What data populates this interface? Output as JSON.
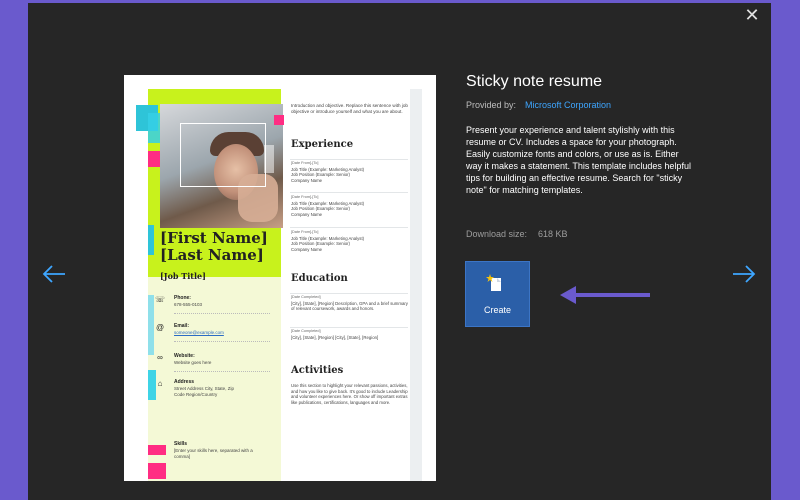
{
  "dialog": {
    "close_glyph": "✕"
  },
  "template": {
    "title": "Sticky note resume",
    "provided_by_label": "Provided by:",
    "provider": "Microsoft Corporation",
    "description": "Present your experience and talent stylishly with this resume or CV.  Includes a space for your photograph.  Easily customize fonts and colors, or use as is.  Either way it makes a statement. This template includes helpful tips for building an effective resume. Search for \"sticky note\" for matching templates.",
    "download_size_label": "Download size:",
    "download_size": "618 KB",
    "create_label": "Create"
  },
  "preview": {
    "name_line1": "[First Name]",
    "name_line2": "[Last Name]",
    "job_title": "[Job Title]",
    "intro": "Introduction and objective. Replace this sentence with job objective or introduce yourself and what you are about.",
    "contact": [
      {
        "icon": "☏",
        "label": "Phone:",
        "value": "678-555-0103"
      },
      {
        "icon": "@",
        "label": "Email:",
        "value": "someone@example.com"
      },
      {
        "icon": "∞",
        "label": "Website:",
        "value": "Website goes here"
      },
      {
        "icon": "⌂",
        "label": "Address",
        "value": "Street Address City, State, Zip Code Region/Country"
      },
      {
        "icon": "",
        "label": "Skills",
        "value": "[Enter your skills here, separated with a comma]"
      }
    ],
    "experience_heading": "Experience",
    "experience": [
      {
        "dates": "[Date From]-[To]",
        "title": "Job Title (Example: Marketing Analyst)",
        "position": "Job Position (Example: Senior)",
        "company": "Company Name"
      },
      {
        "dates": "[Date From]-[To]",
        "title": "Job Title (Example: Marketing Analyst)",
        "position": "Job Position (Example: Senior)",
        "company": "Company Name"
      },
      {
        "dates": "[Date From]-[To]",
        "title": "Job Title (Example: Marketing Analyst)",
        "position": "Job Position (Example: Senior)",
        "company": "Company Name"
      }
    ],
    "education_heading": "Education",
    "education": [
      {
        "dates": "[Date Completed]",
        "text": "[City], [State], [Region] Description, GPA and a brief summary of relevant coursework, awards and honors."
      },
      {
        "dates": "[Date Completed]",
        "text": "[City], [State], [Region] [City], [State], [Region]"
      }
    ],
    "activities_heading": "Activities",
    "activities": "Use this section to highlight your relevant passions, activities, and how you like to give back. It's good to include Leadership and volunteer experiences here. Or show off important extras like publications, certifications, languages and more."
  },
  "colors": {
    "dialog_bg": "#262626",
    "frame_bg": "#6a5acd",
    "accent_link": "#3ea6ff",
    "create_button": "#2b5fa8",
    "annotation_arrow": "#6a5acd",
    "lime": "#c8f21c"
  }
}
